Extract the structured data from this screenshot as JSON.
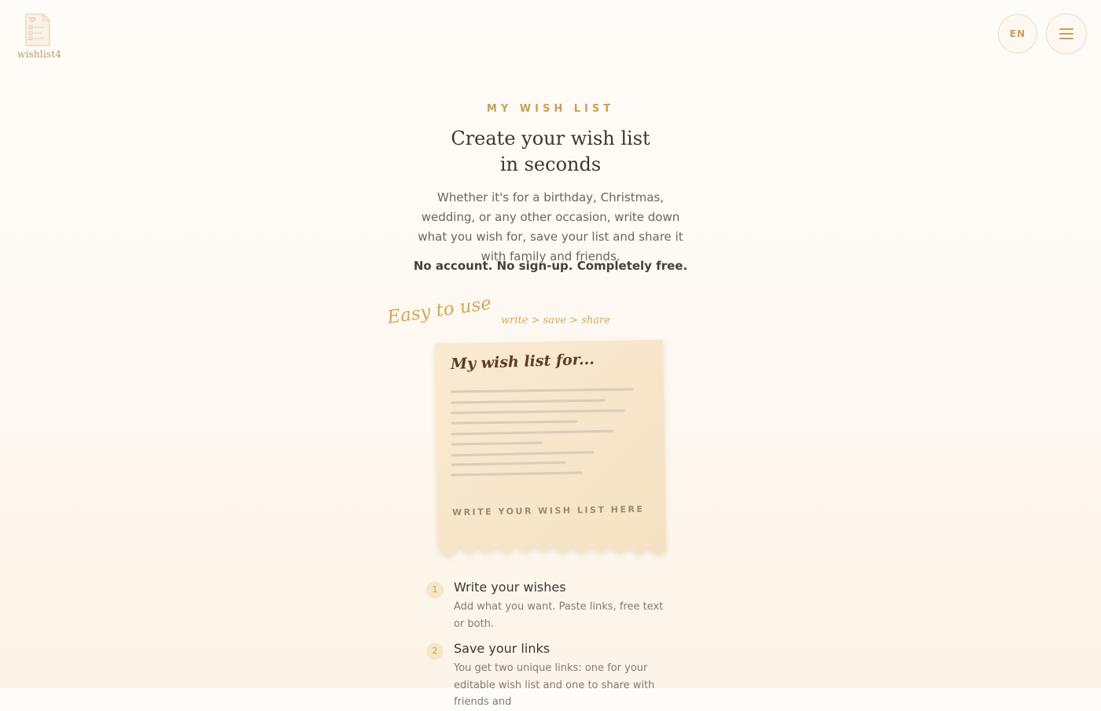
{
  "header": {
    "logo_text": "wishlist4",
    "language": "EN",
    "logo_icon": "wishlist-document-icon",
    "menu_icon": "hamburger-menu-icon"
  },
  "hero": {
    "kicker": "MY WISH LIST",
    "title": "Create your wish list in seconds",
    "description": "Whether it's for a birthday, Christmas, wedding, or any other occasion, write down what you wish for, save your list and share it with family and friends.",
    "free_note": "No account. No sign-up. Completely free."
  },
  "illustration": {
    "easy_label": "Easy to use",
    "flow_hint": "write > save > share",
    "paper_title": "My wish list for...",
    "paper_cta": "WRITE YOUR WISH LIST HERE"
  },
  "steps": [
    {
      "number": "1",
      "title": "Write your wishes",
      "description": "Add what you want. Paste links, free text or both."
    },
    {
      "number": "2",
      "title": "Save your links",
      "description": "You get two unique links: one for your editable wish list and one to share with friends and"
    }
  ],
  "colors": {
    "accent": "#c9a055",
    "paper": "#f8e9d0",
    "text": "#4a4038"
  }
}
